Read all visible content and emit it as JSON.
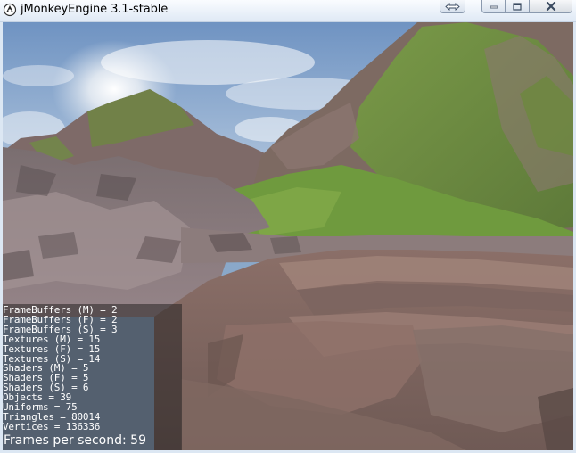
{
  "window": {
    "title": "jMonkeyEngine 3.1-stable"
  },
  "icons": {
    "app": "jmonkey-logo-icon",
    "resize": "resize-arrows-icon",
    "minimize": "minimize-icon",
    "maximize": "maximize-icon",
    "close": "close-icon"
  },
  "stats": [
    "FrameBuffers (M) = 2",
    "FrameBuffers (F) = 2",
    "FrameBuffers (S) = 3",
    "Textures (M) = 15",
    "Textures (F) = 15",
    "Textures (S) = 14",
    "Shaders (M) = 5",
    "Shaders (F) = 5",
    "Shaders (S) = 6",
    "Objects = 39",
    "Uniforms = 75",
    "Triangles = 80014",
    "Vertices = 136336"
  ],
  "fps": "Frames per second: 59",
  "colors": {
    "sky": "#7f9fc8",
    "rock": "#8a7a7a",
    "grass": "#6f9a3a",
    "dirt": "#9a7a6e",
    "stats_bg": "#282424"
  }
}
